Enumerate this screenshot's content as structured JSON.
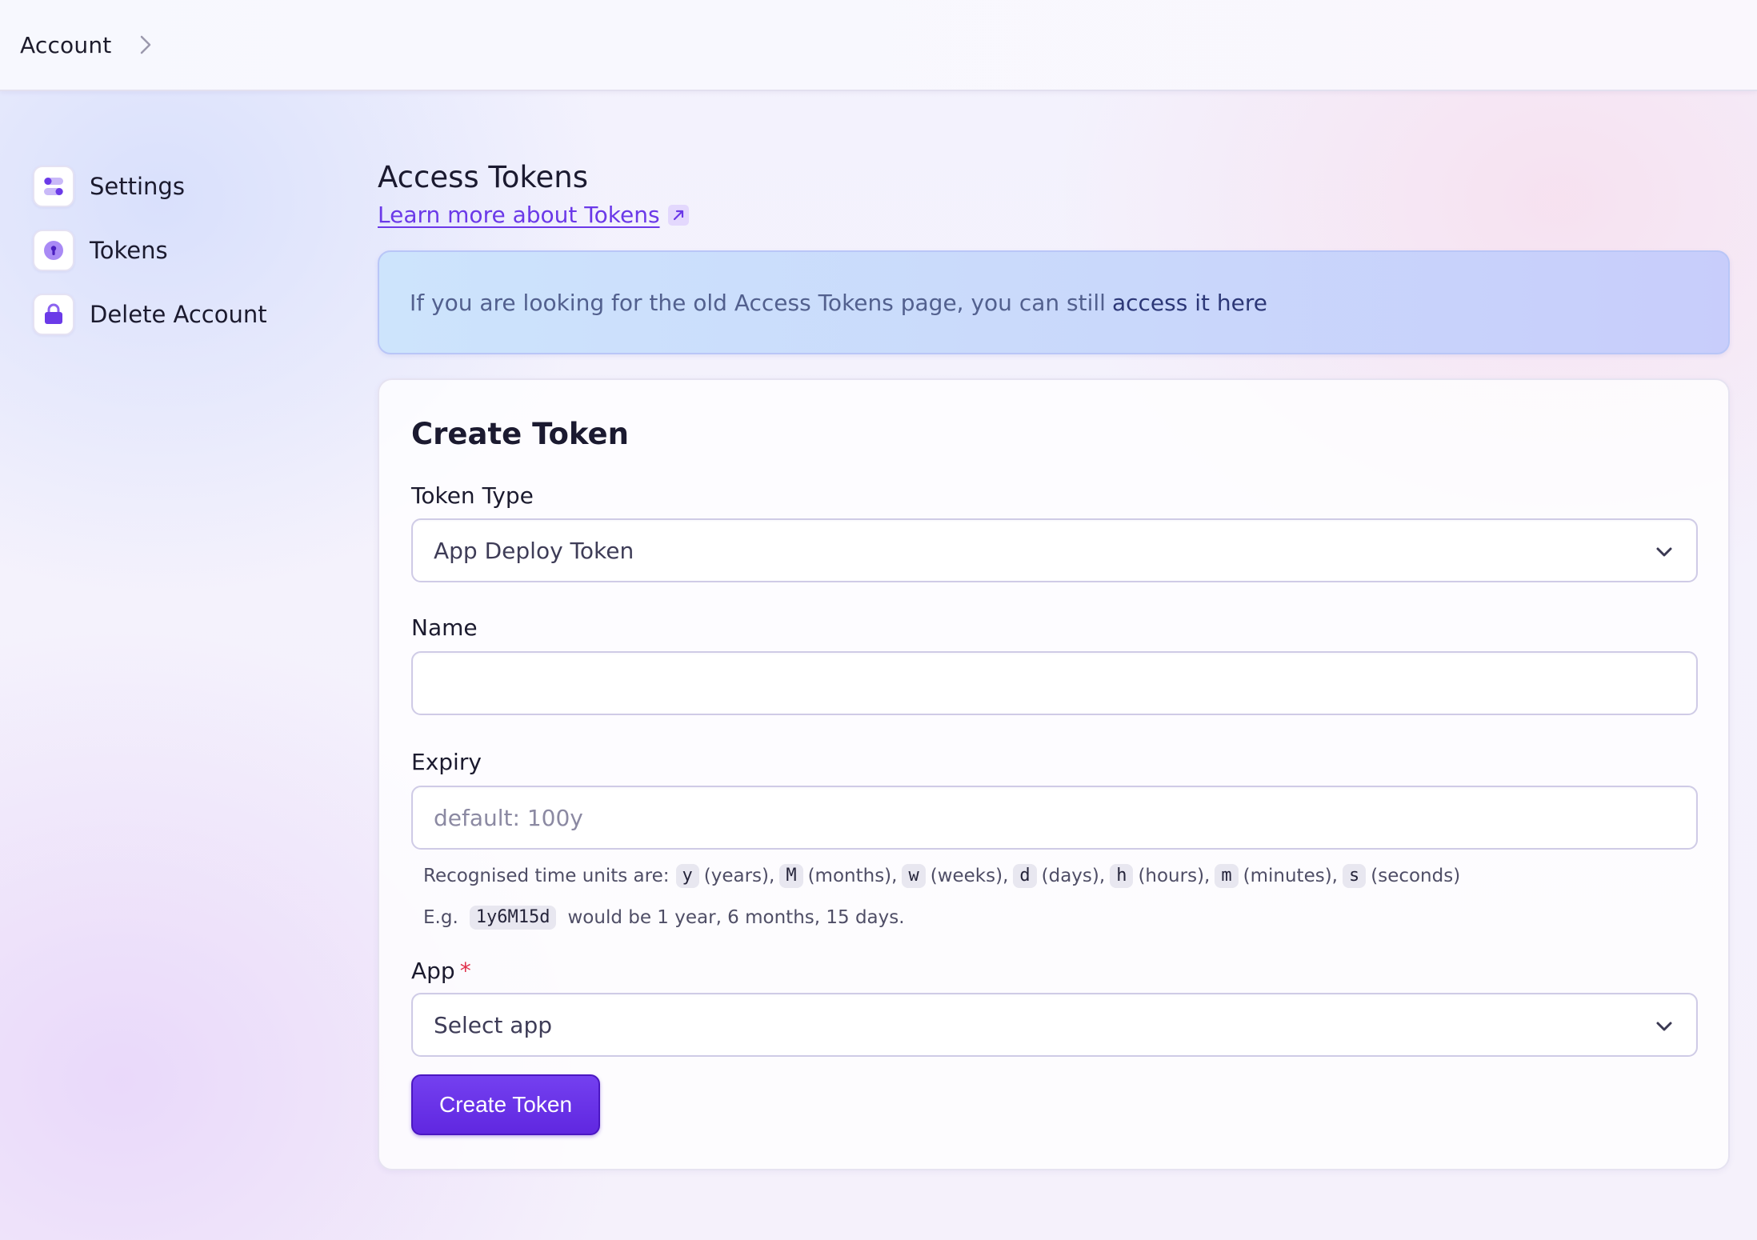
{
  "header": {
    "breadcrumb": "Account",
    "separator_icon": "chevron-right-icon"
  },
  "sidebar": {
    "items": [
      {
        "label": "Settings",
        "icon": "toggles-icon"
      },
      {
        "label": "Tokens",
        "icon": "keyhole-icon"
      },
      {
        "label": "Delete Account",
        "icon": "lock-icon"
      }
    ]
  },
  "main": {
    "title": "Access Tokens",
    "learn_link": "Learn more about Tokens",
    "banner": {
      "text": "If you are looking for the old Access Tokens page, you can still",
      "link": "access it here"
    },
    "form": {
      "title": "Create Token",
      "token_type": {
        "label": "Token Type",
        "value": "App Deploy Token"
      },
      "name": {
        "label": "Name",
        "value": ""
      },
      "expiry": {
        "label": "Expiry",
        "placeholder": "default: 100y",
        "hint_prefix": "Recognised time units are:",
        "units": [
          {
            "code": "y",
            "desc": "(years),"
          },
          {
            "code": "M",
            "desc": "(months),"
          },
          {
            "code": "w",
            "desc": "(weeks),"
          },
          {
            "code": "d",
            "desc": "(days),"
          },
          {
            "code": "h",
            "desc": "(hours),"
          },
          {
            "code": "m",
            "desc": "(minutes),"
          },
          {
            "code": "s",
            "desc": "(seconds)"
          }
        ],
        "example_prefix": "E.g.",
        "example_code": "1y6M15d",
        "example_suffix": "would be 1 year, 6 months, 15 days."
      },
      "app": {
        "label": "App",
        "required_mark": "*",
        "placeholder": "Select app"
      },
      "submit_label": "Create Token"
    }
  },
  "colors": {
    "accent": "#6a35e8",
    "banner_bg": "#c9d8fb",
    "required": "#e0314b"
  }
}
